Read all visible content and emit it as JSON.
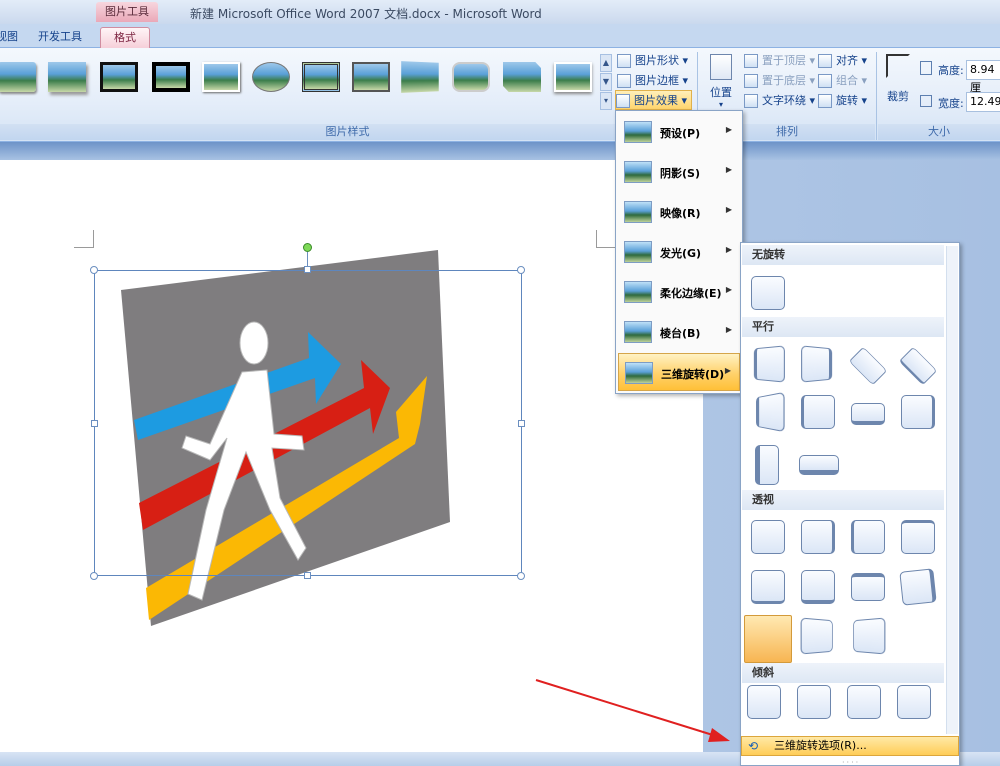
{
  "window": {
    "title": "新建 Microsoft Office Word 2007 文档.docx - Microsoft Word",
    "context_tab_group": "图片工具"
  },
  "tabs": [
    "视图",
    "开发工具",
    "格式"
  ],
  "ribbon": {
    "picture_styles": {
      "label": "图片样式",
      "buttons": {
        "shape": "图片形状",
        "border": "图片边框",
        "effects": "图片效果"
      }
    },
    "arrange": {
      "label": "排列",
      "position": "位置",
      "bring_front": "置于顶层",
      "send_back": "置于底层",
      "text_wrap": "文字环绕",
      "align": "对齐",
      "group": "组合",
      "rotate": "旋转"
    },
    "size": {
      "label": "大小",
      "crop": "裁剪",
      "height_label": "高度:",
      "height_value": "8.94 厘",
      "width_label": "宽度:",
      "width_value": "12.49"
    }
  },
  "effects_menu": [
    {
      "label": "预设(P)"
    },
    {
      "label": "阴影(S)"
    },
    {
      "label": "映像(R)"
    },
    {
      "label": "发光(G)"
    },
    {
      "label": "柔化边缘(E)"
    },
    {
      "label": "棱台(B)"
    },
    {
      "label": "三维旋转(D)"
    }
  ],
  "rotation_menu": {
    "sections": {
      "none": "无旋转",
      "parallel": "平行",
      "perspective": "透视",
      "oblique": "倾斜"
    },
    "options": "三维旋转选项(R)..."
  },
  "colors": {
    "accent": "#ffc037",
    "ribbon": "#dbe7f6",
    "arrow": "#e02020"
  }
}
